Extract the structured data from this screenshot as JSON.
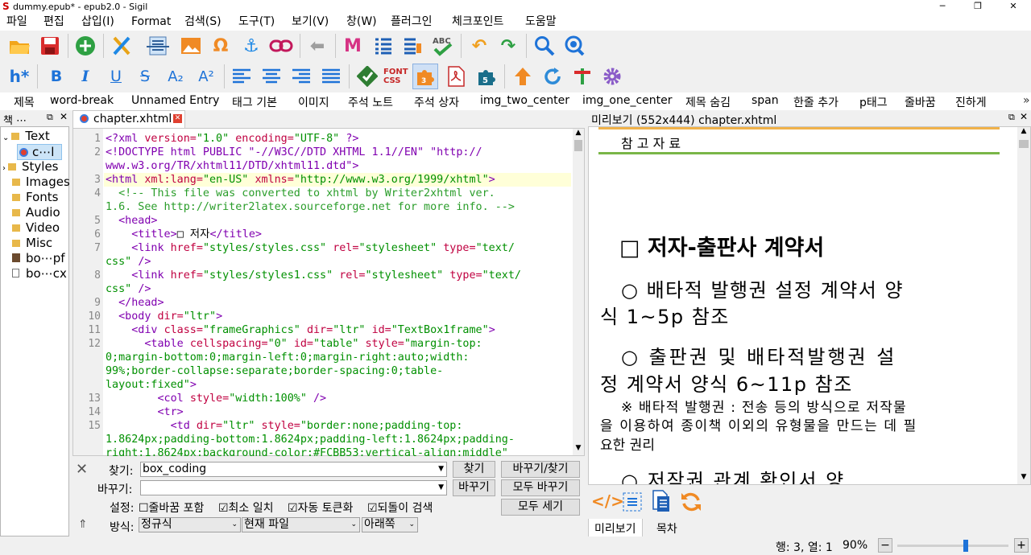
{
  "window": {
    "title": "dummy.epub* - epub2.0 - Sigil",
    "minimize": "─",
    "restore": "❐",
    "close": "✕"
  },
  "menu": [
    "파일",
    "편집",
    "삽입(I)",
    "Format",
    "검색(S)",
    "도구(T)",
    "보기(V)",
    "창(W)",
    "플러그인",
    "체크포인트",
    "도움말"
  ],
  "toolbar2": {
    "heading": "h*",
    "bold": "B",
    "italic": "I",
    "underline": "U",
    "strike": "S",
    "sub": "A₂",
    "sup": "A²",
    "font_css": "FONT CSS"
  },
  "clips": [
    "제목",
    "word-break",
    "Unnamed Entry",
    "태그 기본",
    "이미지",
    "주석 노트",
    "주석 상자",
    "img_two_center",
    "img_one_center",
    "제목 숨김",
    "span",
    "한줄 추가",
    "p태그",
    "줄바꿈",
    "진하게"
  ],
  "book_browser": {
    "title": "책 ⋯",
    "items": [
      "Text",
      "c⋯l",
      "Styles",
      "Images",
      "Fonts",
      "Audio",
      "Video",
      "Misc",
      "bo⋯pf",
      "bo⋯cx"
    ]
  },
  "editor": {
    "tab": "chapter.xhtml",
    "line_numbers": [
      "1",
      "2",
      "",
      "3",
      "4",
      "",
      "5",
      "6",
      "7",
      "",
      "8",
      "",
      "9",
      "10",
      "11",
      "12",
      "",
      "",
      "",
      "13",
      "14",
      "15",
      "",
      ""
    ]
  },
  "find": {
    "find_label": "찾기:",
    "find_value": "box_coding",
    "replace_label": "바꾸기:",
    "replace_value": "",
    "find_btn": "찾기",
    "replace_find_btn": "바꾸기/찾기",
    "replace_btn": "바꾸기",
    "replace_all_btn": "모두 바꾸기",
    "count_all_btn": "모두 세기",
    "settings_label": "설정:",
    "opt1": "☐줄바꿈 포함",
    "opt2": "☑최소 일치",
    "opt3": "☑자동 토큰화",
    "opt4": "☑되돌이 검색",
    "mode_label": "방식:",
    "mode": "정규식",
    "scope": "현재 파일",
    "direction": "아래쪽"
  },
  "preview": {
    "title": "미리보기 (552x444) chapter.xhtml",
    "ref_heading": "참 고 자 료",
    "h1": "□ 저자-출판사 계약서",
    "p1a": "○ 배타적 발행권 설정 계약서 양",
    "p1b": "식 1~5p 참조",
    "p2a": "○  출판권 및 배타적발행권 설",
    "p2b": "정 계약서 양식 6~11p 참조",
    "p3a": "※ 배타적 발행권 : 전송 등의 방식으로 저작물",
    "p3b": "을 이용하여 종이책 이외의 유형물을 만드는 데 필",
    "p3c": "요한 권리",
    "p4": "○    저작권  관계  확인서  양",
    "tab_preview": "미리보기",
    "tab_toc": "목차"
  },
  "status": {
    "position": "행: 3, 열: 1",
    "zoom": "90%",
    "zoom_out": "−",
    "zoom_in": "+",
    "zoom_level": 0.62
  }
}
